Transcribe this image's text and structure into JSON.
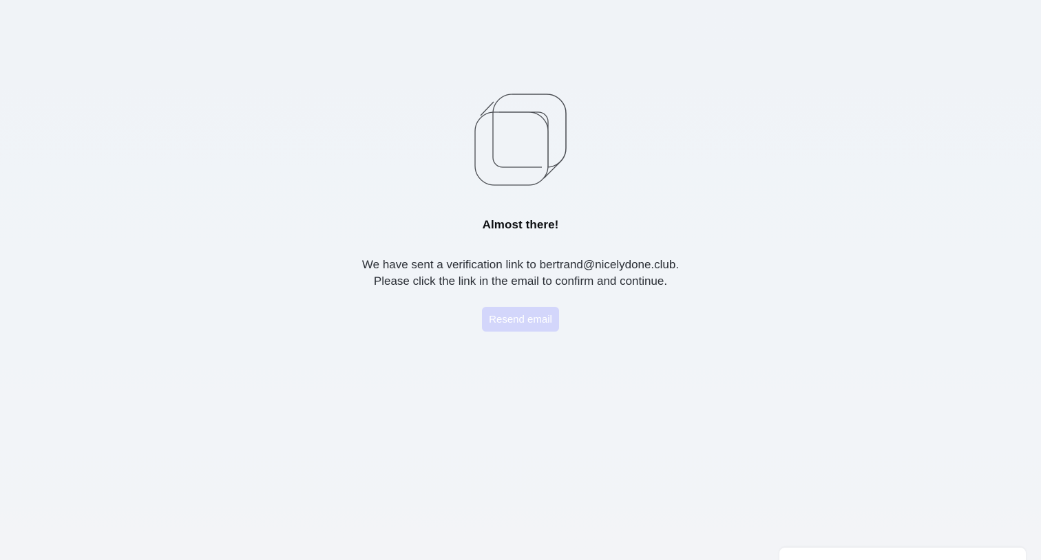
{
  "logo": {
    "icon": "app-logo-icon"
  },
  "heading": "Almost there!",
  "message": {
    "line1": "We have sent a verification link to bertrand@nicelydone.club.",
    "line2": "Please click the link in the email to confirm and continue."
  },
  "resend_button": {
    "label": "Resend email",
    "state": "disabled",
    "color": "#d3d6fb"
  }
}
